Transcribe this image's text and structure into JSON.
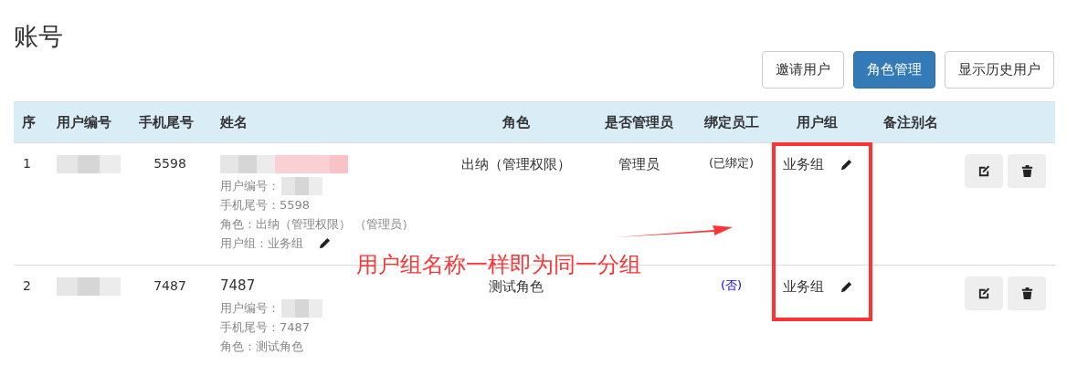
{
  "title": "账号",
  "buttons": [
    {
      "label": "邀请用户",
      "primary": false
    },
    {
      "label": "角色管理",
      "primary": true
    },
    {
      "label": "显示历史用户",
      "primary": false
    }
  ],
  "table": {
    "columns": [
      "序",
      "用户编号",
      "手机尾号",
      "姓名",
      "角色",
      "是否管理员",
      "绑定员工",
      "用户组",
      "备注别名"
    ],
    "rows": [
      {
        "index": "1",
        "user_id_redacted": true,
        "phone_tail": "5598",
        "name": {
          "redacted": true
        },
        "details": [
          {
            "kind": "redacted",
            "label": "用户编号："
          },
          {
            "kind": "text",
            "text": "手机尾号：5598"
          },
          {
            "kind": "text",
            "text": "角色：出纳（管理权限） （管理员）"
          },
          {
            "kind": "editable",
            "text": "用户组：业务组"
          }
        ],
        "role": "出纳（管理权限）",
        "admin": "管理员",
        "bound": {
          "text": "(已绑定)",
          "linked": true
        },
        "group": "业务组"
      },
      {
        "index": "2",
        "user_id_redacted": true,
        "phone_tail": "7487",
        "name": {
          "redacted": false,
          "text": "7487"
        },
        "details": [
          {
            "kind": "redacted",
            "label": "用户编号："
          },
          {
            "kind": "text",
            "text": "手机尾号：7487"
          },
          {
            "kind": "text",
            "text": "角色：测试角色"
          }
        ],
        "role": "测试角色",
        "bound": {
          "text": "(否)",
          "linked": false
        },
        "group": "业务组"
      }
    ]
  },
  "annotation": {
    "text": "用户组名称一样即为同一分组"
  }
}
